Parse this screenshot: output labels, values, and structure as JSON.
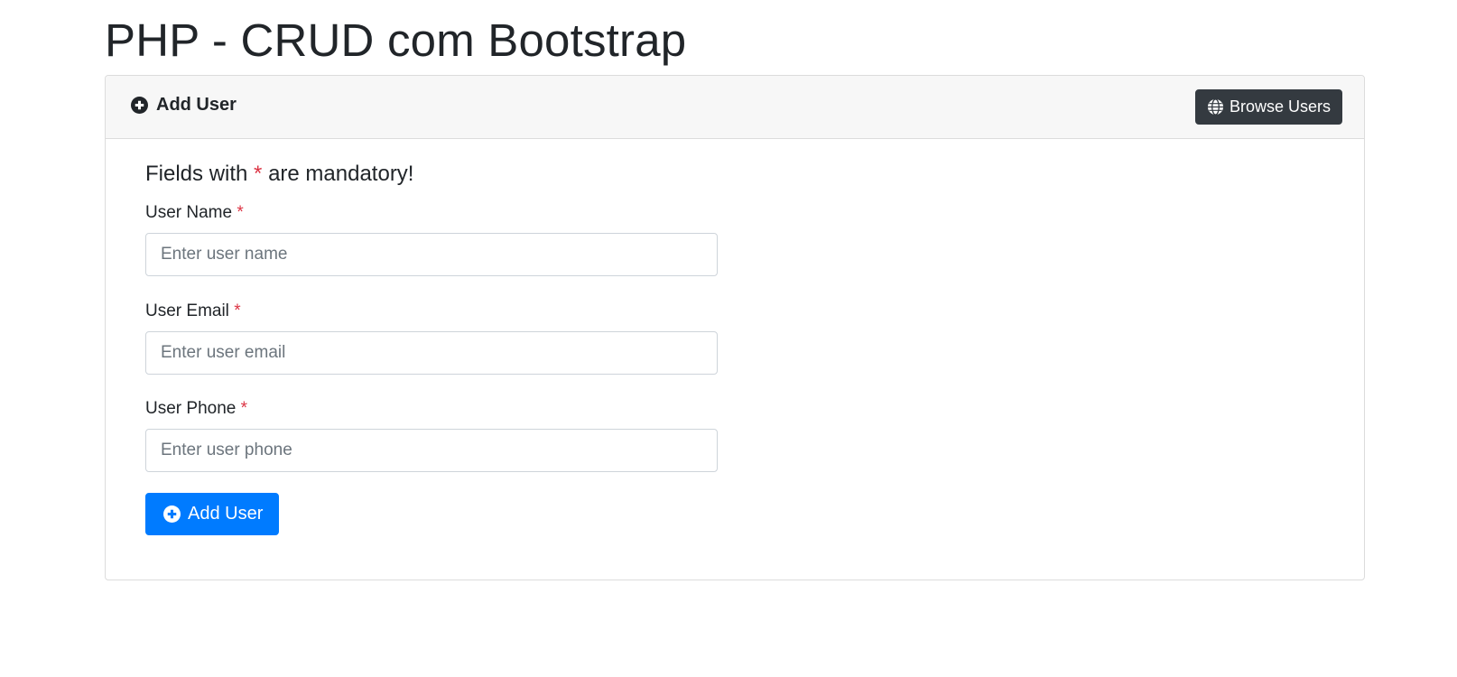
{
  "page": {
    "title": "PHP - CRUD com Bootstrap"
  },
  "card": {
    "header_title": "Add User",
    "header_icon": "plus-circle-icon",
    "browse_button_label": "Browse Users",
    "browse_button_icon": "globe-icon"
  },
  "form": {
    "mandatory_note_before": "Fields with",
    "mandatory_marker": "*",
    "mandatory_note_after": "are mandatory!",
    "fields": [
      {
        "label": "User Name",
        "placeholder": "Enter user name",
        "value": ""
      },
      {
        "label": "User Email",
        "placeholder": "Enter user email",
        "value": ""
      },
      {
        "label": "User Phone",
        "placeholder": "Enter user phone",
        "value": ""
      }
    ],
    "submit_label": "Add User",
    "submit_icon": "plus-circle-icon"
  },
  "colors": {
    "primary": "#007bff",
    "dark": "#343a40",
    "danger": "#dc3545",
    "header_bg": "#f7f7f7"
  }
}
